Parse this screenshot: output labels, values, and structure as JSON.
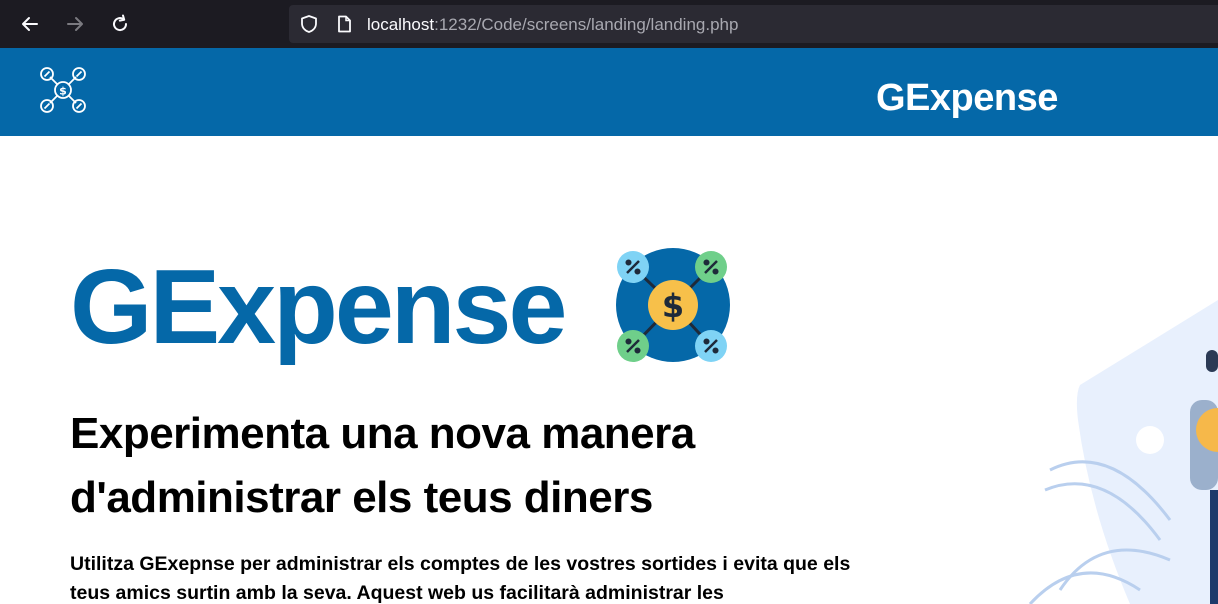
{
  "browser": {
    "url_host": "localhost",
    "url_path": ":1232/Code/screens/landing/landing.php"
  },
  "header": {
    "title": "GExpense"
  },
  "hero": {
    "title": "GExpense",
    "subtitle": "Experimenta una nova manera d'administrar els teus diners",
    "body": "Utilitza GExepnse per administrar els comptes de les vostres sortides i evita que els teus amics surtin amb la seva. Aquest web us facilitarà administrar les"
  },
  "colors": {
    "brand_blue": "#0568a8",
    "chrome_dark": "#1c1b22"
  }
}
